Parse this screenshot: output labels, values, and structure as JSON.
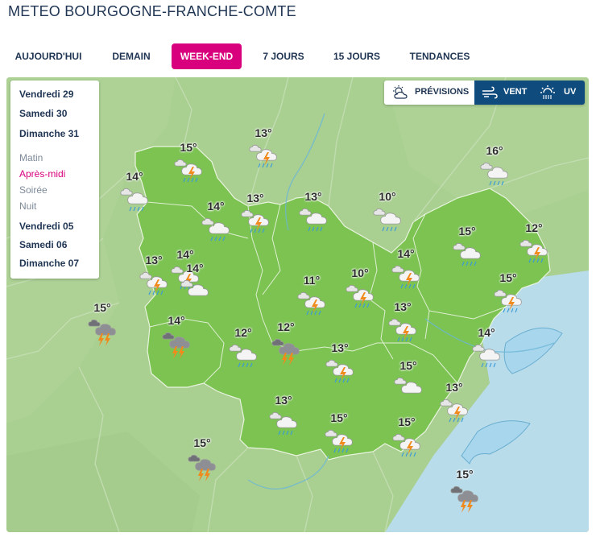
{
  "page": {
    "title": "METEO BOURGOGNE-FRANCHE-COMTE"
  },
  "tabs": [
    {
      "label": "AUJOURD'HUI",
      "active": false
    },
    {
      "label": "DEMAIN",
      "active": false
    },
    {
      "label": "WEEK-END",
      "active": true
    },
    {
      "label": "7 JOURS",
      "active": false
    },
    {
      "label": "15 JOURS",
      "active": false
    },
    {
      "label": "TENDANCES",
      "active": false
    }
  ],
  "days_top": [
    "Vendredi 29",
    "Samedi 30",
    "Dimanche 31"
  ],
  "periods": [
    {
      "label": "Matin",
      "active": false
    },
    {
      "label": "Après-midi",
      "active": true
    },
    {
      "label": "Soirée",
      "active": false
    },
    {
      "label": "Nuit",
      "active": false
    }
  ],
  "days_bottom": [
    "Vendredi 05",
    "Samedi 06",
    "Dimanche 07"
  ],
  "layers": {
    "previsions": "PRÉVISIONS",
    "vent": "VENT",
    "uv": "UV",
    "active": "previsions"
  },
  "colors": {
    "accent": "#d8007c",
    "navy": "#0f4c7d",
    "title": "#1f3553",
    "region": "#7cc352",
    "surrounding": "#a9cf91",
    "lake": "#a8d6ec"
  },
  "forecasts": [
    {
      "temp": "15°",
      "icon": "cloud-rain-thunder-icon"
    },
    {
      "temp": "13°",
      "icon": "cloud-rain-thunder-icon"
    },
    {
      "temp": "14°",
      "icon": "cloud-rain-icon"
    },
    {
      "temp": "14°",
      "icon": "cloud-rain-icon"
    },
    {
      "temp": "14°",
      "icon": "cloud-rain-thunder-icon"
    },
    {
      "temp": "13°",
      "icon": "cloud-rain-thunder-icon"
    },
    {
      "temp": "13°",
      "icon": "cloud-rain-icon"
    },
    {
      "temp": "10°",
      "icon": "cloud-rain-icon"
    },
    {
      "temp": "16°",
      "icon": "cloud-rain-icon"
    },
    {
      "temp": "15°",
      "icon": "cloud-rain-icon"
    },
    {
      "temp": "12°",
      "icon": "cloud-rain-thunder-icon"
    },
    {
      "temp": "14°",
      "icon": "cloud-rain-thunder-icon"
    },
    {
      "temp": "13°",
      "icon": "cloud-rain-thunder-icon"
    },
    {
      "temp": "10°",
      "icon": "cloud-rain-thunder-icon"
    },
    {
      "temp": "11°",
      "icon": "cloud-rain-thunder-icon"
    },
    {
      "temp": "14°",
      "icon": "cloud-icon"
    },
    {
      "temp": "15°",
      "icon": "cloud-rain-thunder-icon"
    },
    {
      "temp": "15°",
      "icon": "storm-cloud-icon"
    },
    {
      "temp": "14°",
      "icon": "storm-cloud-icon"
    },
    {
      "temp": "12°",
      "icon": "cloud-rain-icon"
    },
    {
      "temp": "12°",
      "icon": "storm-cloud-icon"
    },
    {
      "temp": "13°",
      "icon": "cloud-rain-thunder-icon"
    },
    {
      "temp": "14°",
      "icon": "cloud-rain-icon"
    },
    {
      "temp": "13°",
      "icon": "cloud-rain-thunder-icon"
    },
    {
      "temp": "15°",
      "icon": "cloud-icon"
    },
    {
      "temp": "13°",
      "icon": "cloud-rain-icon"
    },
    {
      "temp": "13°",
      "icon": "cloud-rain-thunder-icon"
    },
    {
      "temp": "15°",
      "icon": "cloud-rain-thunder-icon"
    },
    {
      "temp": "15°",
      "icon": "cloud-rain-thunder-icon"
    },
    {
      "temp": "15°",
      "icon": "storm-cloud-icon"
    },
    {
      "temp": "15°",
      "icon": "storm-cloud-icon"
    }
  ]
}
